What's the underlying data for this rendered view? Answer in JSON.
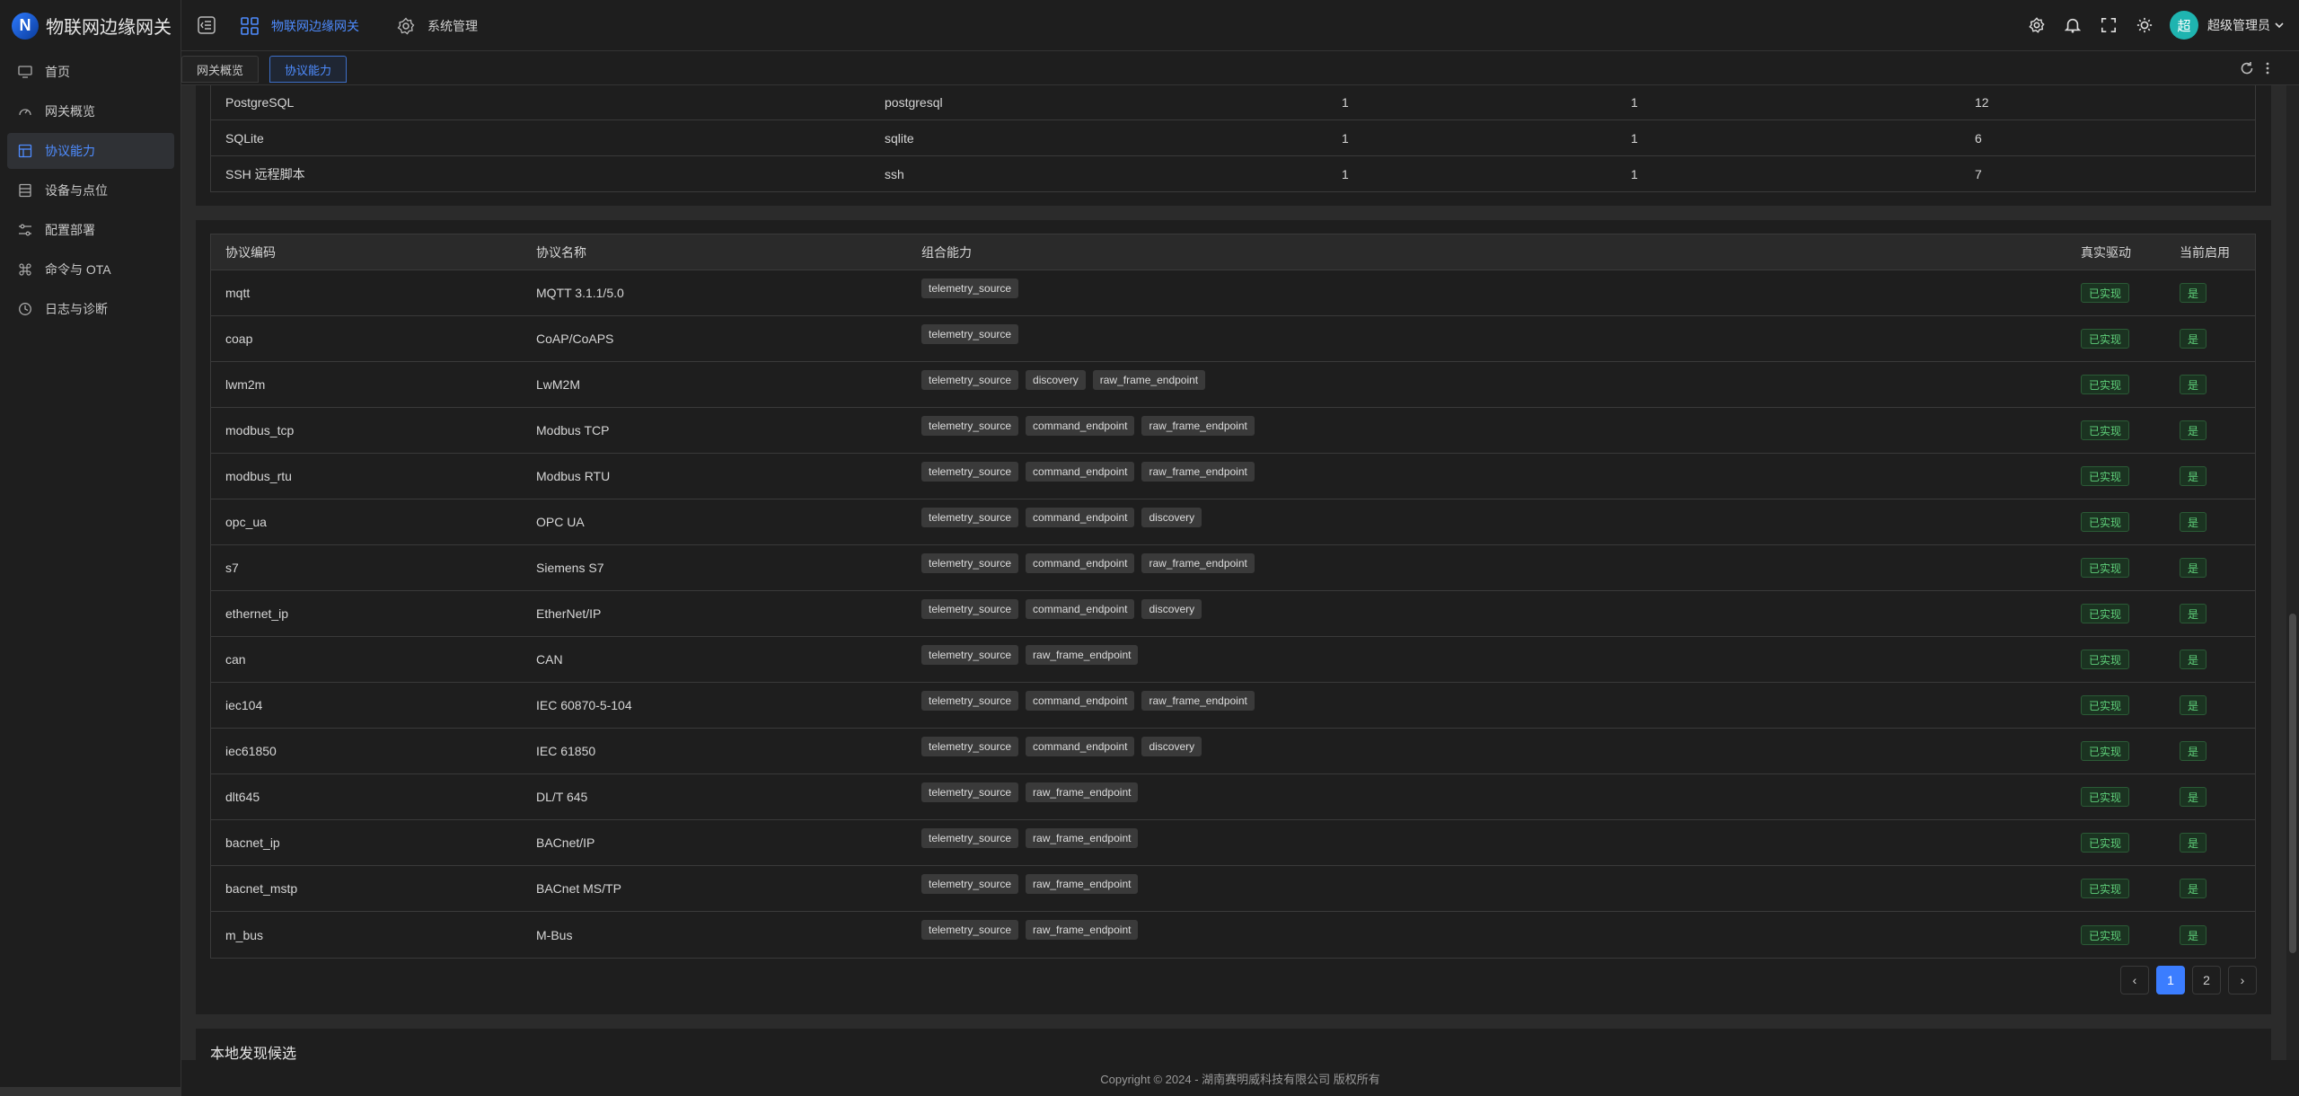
{
  "app": {
    "title": "物联网边缘网关",
    "logo_letter": "N"
  },
  "sidebar": {
    "items": [
      {
        "label": "首页",
        "icon": "monitor-icon",
        "active": false
      },
      {
        "label": "网关概览",
        "icon": "gauge-icon",
        "active": false
      },
      {
        "label": "协议能力",
        "icon": "layout-icon",
        "active": true
      },
      {
        "label": "设备与点位",
        "icon": "list-icon",
        "active": false
      },
      {
        "label": "配置部署",
        "icon": "sliders-icon",
        "active": false
      },
      {
        "label": "命令与 OTA",
        "icon": "command-icon",
        "active": false
      },
      {
        "label": "日志与诊断",
        "icon": "clock-icon",
        "active": false
      }
    ]
  },
  "topbar": {
    "menu": [
      {
        "label": "物联网边缘网关",
        "icon": "grid-icon",
        "active": true
      },
      {
        "label": "系统管理",
        "icon": "gear-icon",
        "active": false
      }
    ],
    "user": {
      "avatar": "超",
      "name": "超级管理员"
    }
  },
  "tabs": [
    {
      "label": "网关概览",
      "active": false
    },
    {
      "label": "协议能力",
      "active": true
    }
  ],
  "db_table": {
    "rows": [
      {
        "name": "PostgreSQL",
        "code": "postgresql",
        "c1": "1",
        "c2": "1",
        "c3": "12"
      },
      {
        "name": "SQLite",
        "code": "sqlite",
        "c1": "1",
        "c2": "1",
        "c3": "6"
      },
      {
        "name": "SSH 远程脚本",
        "code": "ssh",
        "c1": "1",
        "c2": "1",
        "c3": "7"
      }
    ]
  },
  "protocol_table": {
    "headers": {
      "code": "协议编码",
      "name": "协议名称",
      "caps": "组合能力",
      "real": "真实驱动",
      "enabled": "当前启用"
    },
    "rows": [
      {
        "code": "mqtt",
        "name": "MQTT 3.1.1/5.0",
        "caps": [
          "telemetry_source"
        ],
        "real": "已实现",
        "enabled": "是"
      },
      {
        "code": "coap",
        "name": "CoAP/CoAPS",
        "caps": [
          "telemetry_source"
        ],
        "real": "已实现",
        "enabled": "是"
      },
      {
        "code": "lwm2m",
        "name": "LwM2M",
        "caps": [
          "telemetry_source",
          "discovery",
          "raw_frame_endpoint"
        ],
        "real": "已实现",
        "enabled": "是"
      },
      {
        "code": "modbus_tcp",
        "name": "Modbus TCP",
        "caps": [
          "telemetry_source",
          "command_endpoint",
          "raw_frame_endpoint"
        ],
        "real": "已实现",
        "enabled": "是"
      },
      {
        "code": "modbus_rtu",
        "name": "Modbus RTU",
        "caps": [
          "telemetry_source",
          "command_endpoint",
          "raw_frame_endpoint"
        ],
        "real": "已实现",
        "enabled": "是"
      },
      {
        "code": "opc_ua",
        "name": "OPC UA",
        "caps": [
          "telemetry_source",
          "command_endpoint",
          "discovery"
        ],
        "real": "已实现",
        "enabled": "是"
      },
      {
        "code": "s7",
        "name": "Siemens S7",
        "caps": [
          "telemetry_source",
          "command_endpoint",
          "raw_frame_endpoint"
        ],
        "real": "已实现",
        "enabled": "是"
      },
      {
        "code": "ethernet_ip",
        "name": "EtherNet/IP",
        "caps": [
          "telemetry_source",
          "command_endpoint",
          "discovery"
        ],
        "real": "已实现",
        "enabled": "是"
      },
      {
        "code": "can",
        "name": "CAN",
        "caps": [
          "telemetry_source",
          "raw_frame_endpoint"
        ],
        "real": "已实现",
        "enabled": "是"
      },
      {
        "code": "iec104",
        "name": "IEC 60870-5-104",
        "caps": [
          "telemetry_source",
          "command_endpoint",
          "raw_frame_endpoint"
        ],
        "real": "已实现",
        "enabled": "是"
      },
      {
        "code": "iec61850",
        "name": "IEC 61850",
        "caps": [
          "telemetry_source",
          "command_endpoint",
          "discovery"
        ],
        "real": "已实现",
        "enabled": "是"
      },
      {
        "code": "dlt645",
        "name": "DL/T 645",
        "caps": [
          "telemetry_source",
          "raw_frame_endpoint"
        ],
        "real": "已实现",
        "enabled": "是"
      },
      {
        "code": "bacnet_ip",
        "name": "BACnet/IP",
        "caps": [
          "telemetry_source",
          "raw_frame_endpoint"
        ],
        "real": "已实现",
        "enabled": "是"
      },
      {
        "code": "bacnet_mstp",
        "name": "BACnet MS/TP",
        "caps": [
          "telemetry_source",
          "raw_frame_endpoint"
        ],
        "real": "已实现",
        "enabled": "是"
      },
      {
        "code": "m_bus",
        "name": "M-Bus",
        "caps": [
          "telemetry_source",
          "raw_frame_endpoint"
        ],
        "real": "已实现",
        "enabled": "是"
      }
    ]
  },
  "pagination": {
    "prev": "‹",
    "next": "›",
    "pages": [
      "1",
      "2"
    ],
    "current": "1"
  },
  "discovery_section": {
    "title": "本地发现候选"
  },
  "footer": {
    "text": "Copyright © 2024 - 湖南赛明威科技有限公司 版权所有"
  },
  "colors": {
    "accent": "#3b7dff",
    "success": "#5fd07a"
  }
}
